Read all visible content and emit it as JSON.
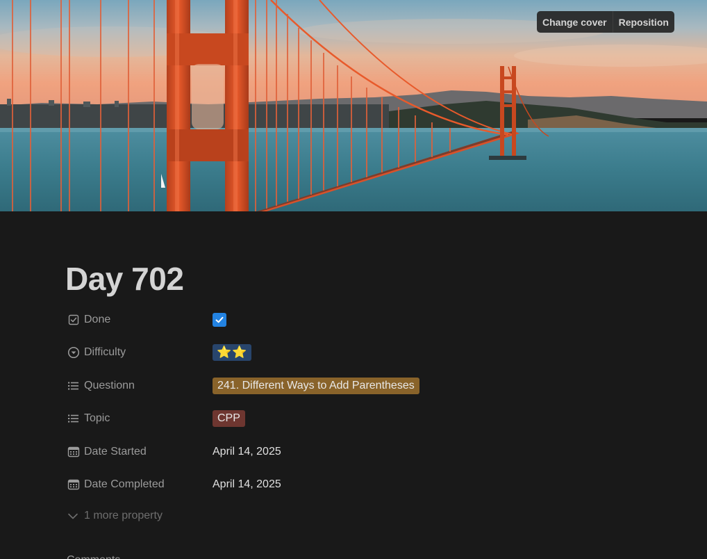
{
  "cover": {
    "image": "golden-gate-bridge-sunset-photo",
    "buttons": {
      "change_cover": "Change cover",
      "reposition": "Reposition"
    }
  },
  "page": {
    "title": "Day 702"
  },
  "properties": [
    {
      "label": "Done",
      "icon": "checkbox-icon",
      "type": "checkbox",
      "checked": true
    },
    {
      "label": "Difficulty",
      "icon": "select-icon",
      "type": "select",
      "value": "⭐⭐",
      "color": "#28456c"
    },
    {
      "label": "Questionn",
      "icon": "list-icon",
      "type": "multi_select",
      "value": "241. Different Ways to Add Parentheses",
      "color": "#89632a"
    },
    {
      "label": "Topic",
      "icon": "list-icon",
      "type": "multi_select",
      "value": "CPP",
      "color": "#6e3630"
    },
    {
      "label": "Date Started",
      "icon": "calendar-icon",
      "type": "date",
      "value": "April 14, 2025"
    },
    {
      "label": "Date Completed",
      "icon": "calendar-icon",
      "type": "date",
      "value": "April 14, 2025"
    }
  ],
  "more_properties": {
    "label": "1 more property",
    "icon": "chevron-down-icon"
  },
  "comments": {
    "label": "Comments"
  },
  "colors": {
    "background": "#191919",
    "text_primary": "#d4d4d4",
    "text_secondary": "#9b9b9b",
    "checkbox_blue": "#2383e2"
  }
}
